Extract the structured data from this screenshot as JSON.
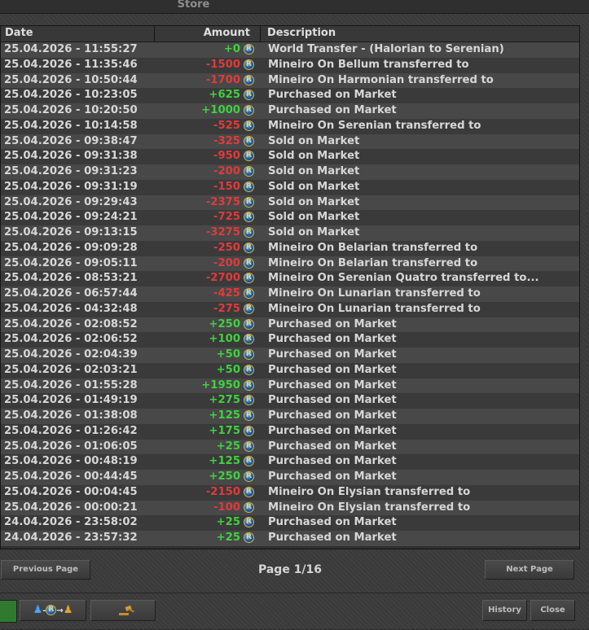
{
  "window": {
    "title": "Store"
  },
  "table": {
    "headers": {
      "date": "Date",
      "amount": "Amount",
      "description": "Description"
    },
    "currency_icon": "coin-icon",
    "currency_symbol": "R",
    "rows": [
      {
        "date": "25.04.2026 - 11:55:27",
        "amount": "+0",
        "sign": "pos",
        "description": "World Transfer - (Halorian to Serenian)"
      },
      {
        "date": "25.04.2026 - 11:35:46",
        "amount": "-1500",
        "sign": "neg",
        "description": "Mineiro On Bellum transferred to"
      },
      {
        "date": "25.04.2026 - 10:50:44",
        "amount": "-1700",
        "sign": "neg",
        "description": "Mineiro On Harmonian transferred to"
      },
      {
        "date": "25.04.2026 - 10:23:05",
        "amount": "+625",
        "sign": "pos",
        "description": "Purchased on Market"
      },
      {
        "date": "25.04.2026 - 10:20:50",
        "amount": "+1000",
        "sign": "pos",
        "description": "Purchased on Market"
      },
      {
        "date": "25.04.2026 - 10:14:58",
        "amount": "-525",
        "sign": "neg",
        "description": "Mineiro On Serenian transferred to"
      },
      {
        "date": "25.04.2026 - 09:38:47",
        "amount": "-325",
        "sign": "neg",
        "description": "Sold on Market"
      },
      {
        "date": "25.04.2026 - 09:31:38",
        "amount": "-950",
        "sign": "neg",
        "description": "Sold on Market"
      },
      {
        "date": "25.04.2026 - 09:31:23",
        "amount": "-200",
        "sign": "neg",
        "description": "Sold on Market"
      },
      {
        "date": "25.04.2026 - 09:31:19",
        "amount": "-150",
        "sign": "neg",
        "description": "Sold on Market"
      },
      {
        "date": "25.04.2026 - 09:29:43",
        "amount": "-2375",
        "sign": "neg",
        "description": "Sold on Market"
      },
      {
        "date": "25.04.2026 - 09:24:21",
        "amount": "-725",
        "sign": "neg",
        "description": "Sold on Market"
      },
      {
        "date": "25.04.2026 - 09:13:15",
        "amount": "-3275",
        "sign": "neg",
        "description": "Sold on Market"
      },
      {
        "date": "25.04.2026 - 09:09:28",
        "amount": "-250",
        "sign": "neg",
        "description": "Mineiro On Belarian transferred to"
      },
      {
        "date": "25.04.2026 - 09:05:11",
        "amount": "-200",
        "sign": "neg",
        "description": "Mineiro On Belarian transferred to"
      },
      {
        "date": "25.04.2026 - 08:53:21",
        "amount": "-2700",
        "sign": "neg",
        "description": "Mineiro On Serenian Quatro transferred to..."
      },
      {
        "date": "25.04.2026 - 06:57:44",
        "amount": "-425",
        "sign": "neg",
        "description": "Mineiro On Lunarian transferred to"
      },
      {
        "date": "25.04.2026 - 04:32:48",
        "amount": "-275",
        "sign": "neg",
        "description": "Mineiro On Lunarian transferred to"
      },
      {
        "date": "25.04.2026 - 02:08:52",
        "amount": "+250",
        "sign": "pos",
        "description": "Purchased on Market"
      },
      {
        "date": "25.04.2026 - 02:06:52",
        "amount": "+100",
        "sign": "pos",
        "description": "Purchased on Market"
      },
      {
        "date": "25.04.2026 - 02:04:39",
        "amount": "+50",
        "sign": "pos",
        "description": "Purchased on Market"
      },
      {
        "date": "25.04.2026 - 02:03:21",
        "amount": "+50",
        "sign": "pos",
        "description": "Purchased on Market"
      },
      {
        "date": "25.04.2026 - 01:55:28",
        "amount": "+1950",
        "sign": "pos",
        "description": "Purchased on Market"
      },
      {
        "date": "25.04.2026 - 01:49:19",
        "amount": "+275",
        "sign": "pos",
        "description": "Purchased on Market"
      },
      {
        "date": "25.04.2026 - 01:38:08",
        "amount": "+125",
        "sign": "pos",
        "description": "Purchased on Market"
      },
      {
        "date": "25.04.2026 - 01:26:42",
        "amount": "+175",
        "sign": "pos",
        "description": "Purchased on Market"
      },
      {
        "date": "25.04.2026 - 01:06:05",
        "amount": "+25",
        "sign": "pos",
        "description": "Purchased on Market"
      },
      {
        "date": "25.04.2026 - 00:48:19",
        "amount": "+125",
        "sign": "pos",
        "description": "Purchased on Market"
      },
      {
        "date": "25.04.2026 - 00:44:45",
        "amount": "+250",
        "sign": "pos",
        "description": "Purchased on Market"
      },
      {
        "date": "25.04.2026 - 00:04:45",
        "amount": "-2150",
        "sign": "neg",
        "description": "Mineiro On Elysian transferred to"
      },
      {
        "date": "25.04.2026 - 00:00:21",
        "amount": "-100",
        "sign": "neg",
        "description": "Mineiro On Elysian transferred to"
      },
      {
        "date": "24.04.2026 - 23:58:02",
        "amount": "+25",
        "sign": "pos",
        "description": "Purchased on Market"
      },
      {
        "date": "24.04.2026 - 23:57:32",
        "amount": "+25",
        "sign": "pos",
        "description": "Purchased on Market"
      }
    ]
  },
  "pagination": {
    "prev_label": "Previous Page",
    "page_label": "Page 1/16",
    "next_label": "Next Page"
  },
  "footer": {
    "history_label": "History",
    "close_label": "Close",
    "transfer_icon": "coin-transfer-icon",
    "auction_icon": "gavel-icon"
  },
  "colors": {
    "positive": "#3fd13f",
    "negative": "#e23a3a",
    "row_odd": "#484848",
    "row_even": "#3a3a3a"
  }
}
